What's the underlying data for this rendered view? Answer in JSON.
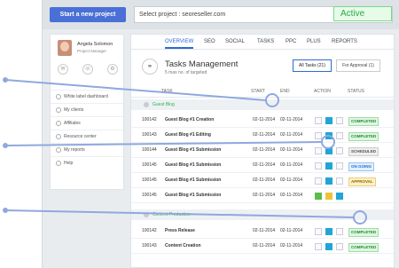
{
  "topbar": {
    "new_project_label": "Start a new project",
    "project_select_text": "Select project : seoreseller.com",
    "status": "Active"
  },
  "user": {
    "name": "Angela Solomon",
    "role": "Project Manager"
  },
  "sidebar": {
    "items": [
      {
        "label": "White label dashboard"
      },
      {
        "label": "My clients"
      },
      {
        "label": "Affiliates"
      },
      {
        "label": "Resource center"
      },
      {
        "label": "My reports"
      },
      {
        "label": "Help"
      }
    ]
  },
  "tabs": [
    "OVERVIEW",
    "SEO",
    "SOCIAL",
    "TASKS",
    "PPC",
    "PLUS",
    "REPORTS"
  ],
  "page": {
    "title": "Tasks Management",
    "subtitle": "5 max no. of targeted",
    "all_tasks": "All Tasks (21)",
    "for_approval": "For Approval (1)"
  },
  "columns": [
    "TASK",
    "START",
    "END",
    "ACTION",
    "STATUS"
  ],
  "group1": "Guest Blog",
  "rows1": [
    {
      "id": "100142",
      "name": "Guest Blog #1 Creation",
      "start": "02-11-2014",
      "end": "02-11-2014",
      "status": "COMPLETED"
    },
    {
      "id": "100143",
      "name": "Guest Blog #1 Editing",
      "start": "02-11-2014",
      "end": "02-11-2014",
      "status": "COMPLETED"
    },
    {
      "id": "100144",
      "name": "Guest Blog #1 Submission",
      "start": "02-11-2014",
      "end": "02-11-2014",
      "status": "SCHEDULED"
    },
    {
      "id": "100145",
      "name": "Guest Blog #1 Submission",
      "start": "02-11-2014",
      "end": "02-11-2014",
      "status": "ON GOING"
    },
    {
      "id": "100145",
      "name": "Guest Blog #1 Submission",
      "start": "02-11-2014",
      "end": "02-11-2014",
      "status": "APPROVAL"
    },
    {
      "id": "100145",
      "name": "Guest Blog #1 Submission",
      "start": "02-11-2014",
      "end": "02-11-2014",
      "status": ""
    }
  ],
  "group2": "Content Production",
  "rows2": [
    {
      "id": "100142",
      "name": "Press Release",
      "start": "02-11-2014",
      "end": "02-11-2014",
      "status": "COMPLETED"
    },
    {
      "id": "100143",
      "name": "Content Creation",
      "start": "02-11-2014",
      "end": "02-11-2014",
      "status": "COMPLETED"
    }
  ],
  "colors": {
    "accent": "#2b6bd1",
    "pointer": "#8fa8df"
  }
}
